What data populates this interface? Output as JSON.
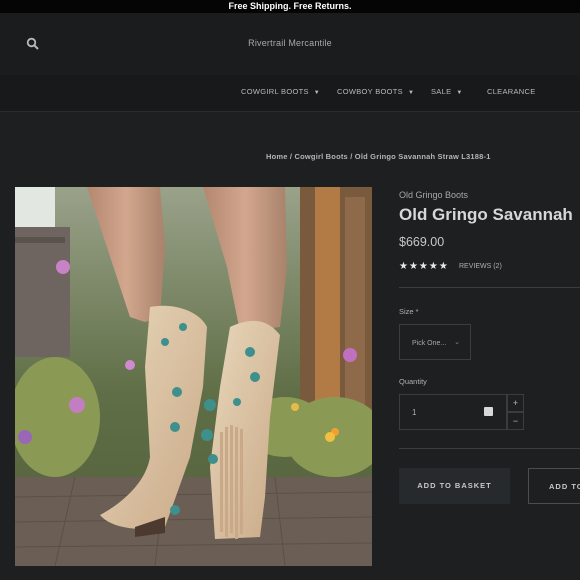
{
  "announcement": "Free Shipping. Free Returns.",
  "header": {
    "store_name": "Rivertrail Mercantile",
    "search_icon": "search-icon"
  },
  "nav": {
    "items": [
      {
        "label": "COWGIRL BOOTS",
        "has_dropdown": true
      },
      {
        "label": "COWBOY BOOTS",
        "has_dropdown": true
      },
      {
        "label": "SALE",
        "has_dropdown": true
      },
      {
        "label": "CLEARANCE",
        "has_dropdown": false
      }
    ]
  },
  "breadcrumb": {
    "home": "Home",
    "sep": " / ",
    "category": "Cowgirl Boots",
    "current": "Old Gringo Savannah Straw L3188-1"
  },
  "product": {
    "brand": "Old Gringo Boots",
    "title": "Old Gringo Savannah",
    "price": "$669.00",
    "rating": 5,
    "stars": "★★★★★",
    "reviews_label": "REVIEWS (2)",
    "size_label": "Size *",
    "size_value": "Pick One...",
    "quantity_label": "Quantity",
    "quantity_value": "1",
    "plus": "+",
    "minus": "−",
    "add_to_basket": "ADD TO BASKET",
    "second_button": "ADD TO"
  },
  "colors": {
    "background": "#1d1f21",
    "accent_turquoise": "#3f8f8c",
    "boot_tan": "#d8c2a0"
  }
}
